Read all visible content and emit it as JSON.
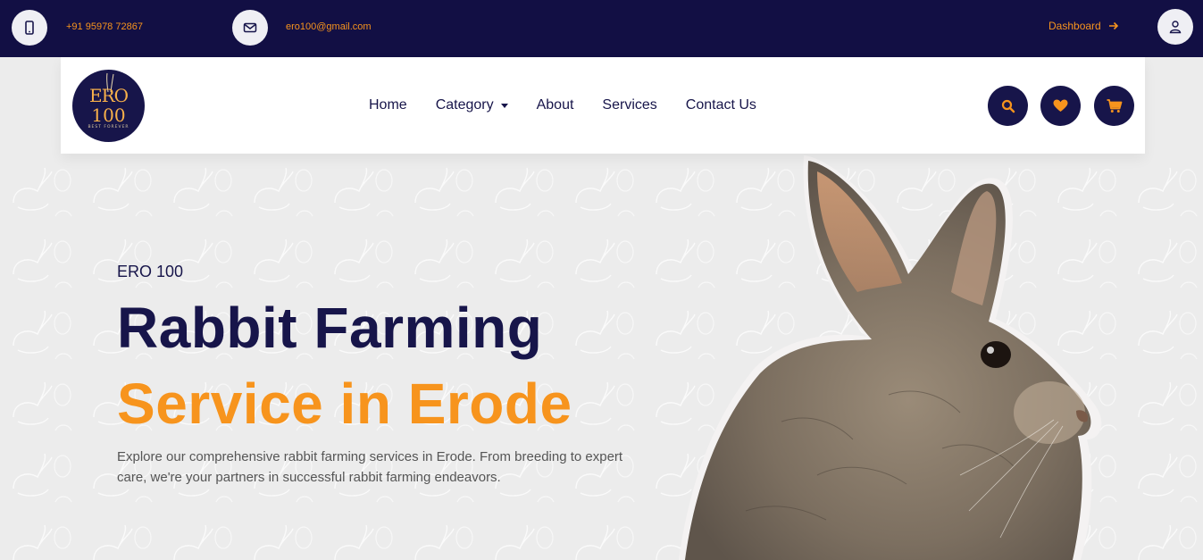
{
  "topbar": {
    "phone_icon": "mobile-phone-icon",
    "phone": "+91 95978 72867",
    "email_icon": "envelope-icon",
    "email": "ero100@gmail.com",
    "dashboard_label": "Dashboard",
    "user_icon": "user-icon"
  },
  "logo": {
    "line1": "ERO",
    "line2": "100",
    "tagline": "BEST FOREVER"
  },
  "nav": {
    "items": [
      {
        "label": "Home"
      },
      {
        "label": "Category"
      },
      {
        "label": "About"
      },
      {
        "label": "Services"
      },
      {
        "label": "Contact Us"
      }
    ],
    "search_icon": "search-icon",
    "wishlist_icon": "heart-icon",
    "cart_icon": "cart-icon"
  },
  "hero": {
    "eyebrow": "ERO 100",
    "title_line1": "Rabbit Farming",
    "title_line2": "Service in Erode",
    "description": "Explore our comprehensive rabbit farming services in Erode. From breeding to expert care, we're your partners in successful rabbit farming endeavors."
  },
  "colors": {
    "navy": "#17154a",
    "topbar": "#120f44",
    "accent": "#f7941d",
    "hero_bg": "#ececec"
  }
}
